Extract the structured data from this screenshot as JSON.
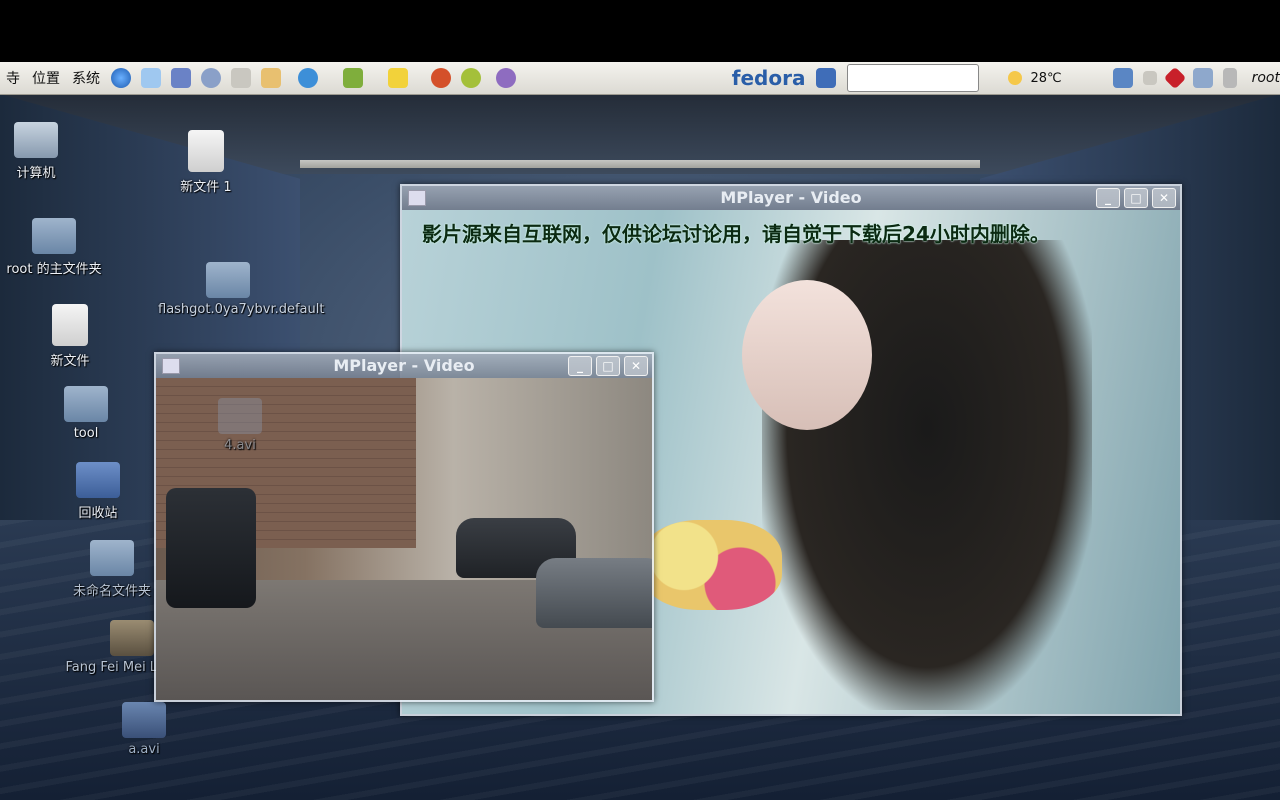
{
  "panel": {
    "menus": [
      "寺",
      "位置",
      "系统"
    ],
    "brand": "fedora",
    "weather_temp": "28℃",
    "user": "root",
    "search_value": ""
  },
  "desktop_icons": [
    {
      "label": "计算机",
      "icon": "computer-icon"
    },
    {
      "label": "新文件 1",
      "icon": "document-icon"
    },
    {
      "label": "root 的主文件夹",
      "icon": "home-folder-icon"
    },
    {
      "label": "flashgot.0ya7ybvr.default",
      "icon": "folder-icon"
    },
    {
      "label": "新文件",
      "icon": "document-icon"
    },
    {
      "label": "tool",
      "icon": "folder-icon"
    },
    {
      "label": "回收站",
      "icon": "trash-icon"
    },
    {
      "label": "未命名文件夹",
      "icon": "folder-icon"
    },
    {
      "label": "Fang Fei Mei Li.rmvb",
      "icon": "video-file-icon"
    },
    {
      "label": "a.avi",
      "icon": "video-file-icon"
    },
    {
      "label": "4.avi",
      "icon": "video-file-icon"
    }
  ],
  "windows": {
    "large": {
      "title": "MPlayer - Video",
      "subtitle": "影片源来自互联网，仅供论坛讨论用，请自觉于下载后24小时内删除。"
    },
    "small": {
      "title": "MPlayer - Video"
    }
  },
  "window_buttons": {
    "minimize": "_",
    "maximize": "□",
    "close": "✕"
  }
}
